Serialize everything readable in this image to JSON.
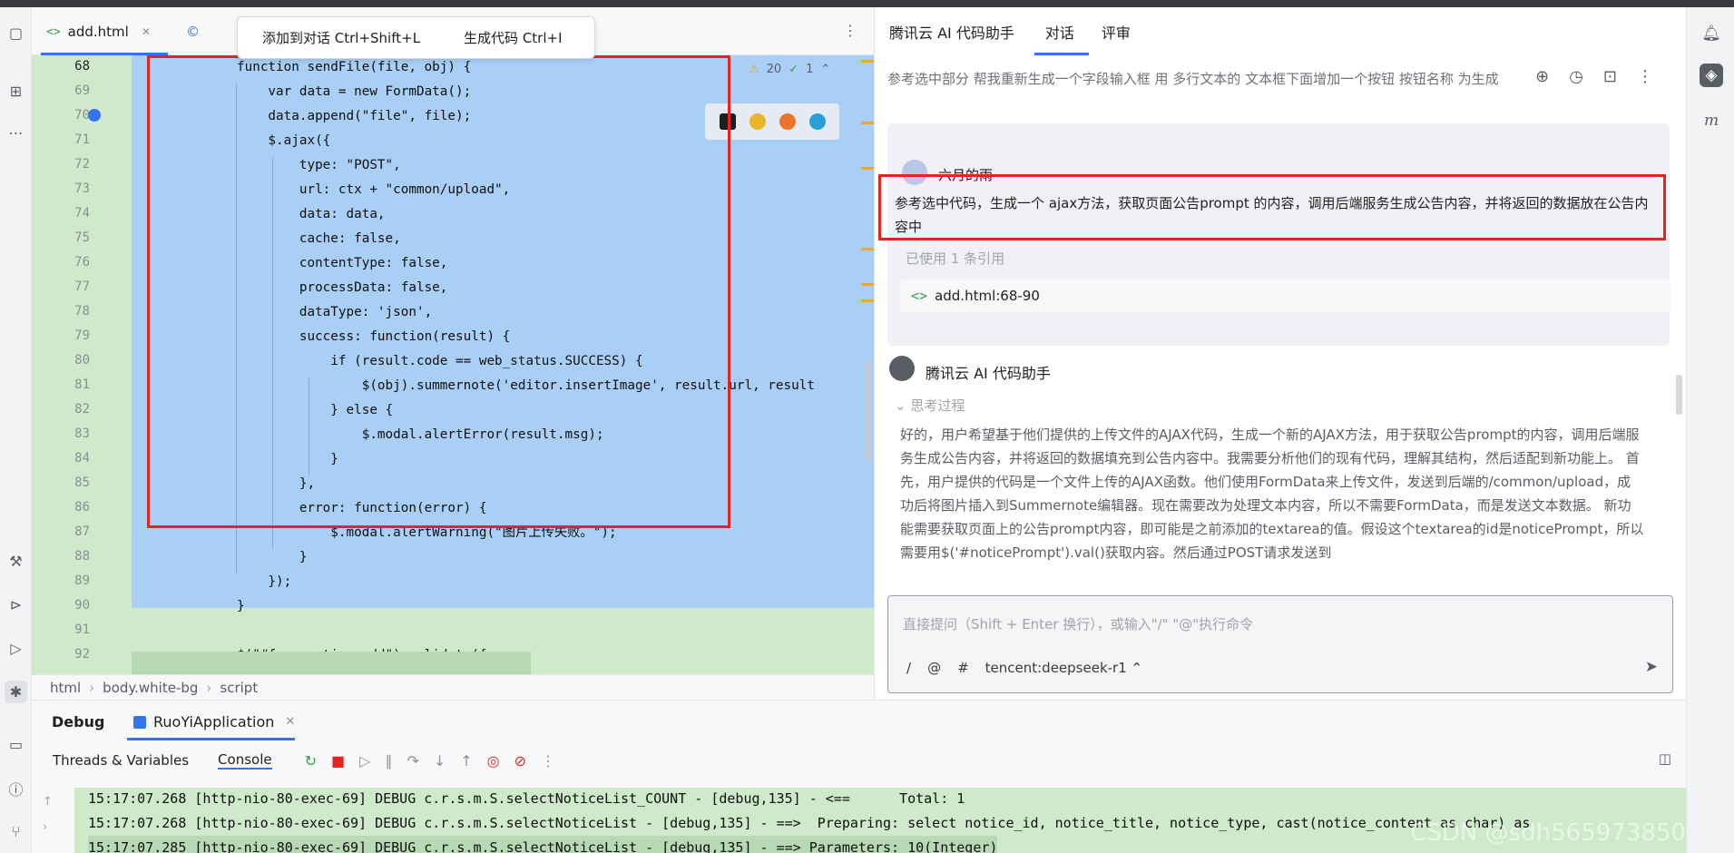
{
  "editor": {
    "tabs": [
      {
        "tag": "<>",
        "label": "add.html"
      }
    ],
    "popup": {
      "add_to_chat": "添加到对话 Ctrl+Shift+L",
      "generate_code": "生成代码 Ctrl+I"
    },
    "warnings": {
      "warn_count": "20",
      "ok_count": "1"
    },
    "line_numbers": [
      "68",
      "69",
      "70",
      "71",
      "72",
      "73",
      "74",
      "75",
      "76",
      "77",
      "78",
      "79",
      "80",
      "81",
      "82",
      "83",
      "84",
      "85",
      "86",
      "87",
      "88",
      "89",
      "90",
      "91",
      "92"
    ],
    "code": [
      "function sendFile(file, obj) {",
      "    var data = new FormData();",
      "    data.append(\"file\", file);",
      "    $.ajax({",
      "        type: \"POST\",",
      "        url: ctx + \"common/upload\",",
      "        data: data,",
      "        cache: false,",
      "        contentType: false,",
      "        processData: false,",
      "        dataType: 'json',",
      "        success: function(result) {",
      "            if (result.code == web_status.SUCCESS) {",
      "                $(obj).summernote('editor.insertImage', result.url, result",
      "            } else {",
      "                $.modal.alertError(result.msg);",
      "            }",
      "        },",
      "        error: function(error) {",
      "            $.modal.alertWarning(\"图片上传失败。\");",
      "        }",
      "    });",
      "}",
      "",
      "$(\"#form-notice-add\").validate({"
    ],
    "breadcrumb": [
      "html",
      "body.white-bg",
      "script"
    ]
  },
  "assistant": {
    "title": "腾讯云 AI 代码助手",
    "tabs": [
      "对话",
      "评审"
    ],
    "subtitle": "参考选中部分 帮我重新生成一个字段输入框 用 多行文本的 文本框下面增加一个按钮 按钮名称 为生成",
    "user_name": "六月的雨",
    "user_message": "参考选中代码，生成一个 ajax方法，获取页面公告prompt 的内容，调用后端服务生成公告内容，并将返回的数据放在公告内容中",
    "used_refs": "已使用 1 条引用",
    "ref_file": "add.html:68-90",
    "bot_name": "腾讯云 AI 代码助手",
    "thinking_label": "思考过程",
    "thinking_text": "好的，用户希望基于他们提供的上传文件的AJAX代码，生成一个新的AJAX方法，用于获取公告prompt的内容，调用后端服务生成公告内容，并将返回的数据填充到公告内容中。我需要分析他们的现有代码，理解其结构，然后适配到新功能上。 首先，用户提供的代码是一个文件上传的AJAX函数。他们使用FormData来上传文件，发送到后端的/common/upload，成功后将图片插入到Summernote编辑器。现在需要改为处理文本内容，所以不需要FormData，而是发送文本数据。 新功能需要获取页面上的公告prompt内容，即可能是之前添加的textarea的值。假设这个textarea的id是noticePrompt，所以需要用$('#noticePrompt').val()获取内容。然后通过POST请求发送到",
    "input_placeholder": "直接提问（Shift + Enter 换行），或输入\"/\" \"@\"执行命令",
    "model": "tencent:deepseek-r1"
  },
  "debug": {
    "title": "Debug",
    "run_tab": "RuoYiApplication",
    "sub_tabs": [
      "Threads & Variables",
      "Console"
    ],
    "console_lines": [
      "15:17:07.268 [http-nio-80-exec-69] DEBUG c.r.s.m.S.selectNoticeList_COUNT - [debug,135] - <==      Total: 1",
      "15:17:07.268 [http-nio-80-exec-69] DEBUG c.r.s.m.S.selectNoticeList - [debug,135] - ==>  Preparing: select notice_id, notice_title, notice_type, cast(notice_content as char) as",
      "15:17:07.285 [http-nio-80-exec-69] DEBUG c.r.s.m.S.selectNoticeList - [debug,135] - ==> Parameters: 10(Integer)"
    ],
    "watermark": "CSDN @sdh565973850"
  }
}
